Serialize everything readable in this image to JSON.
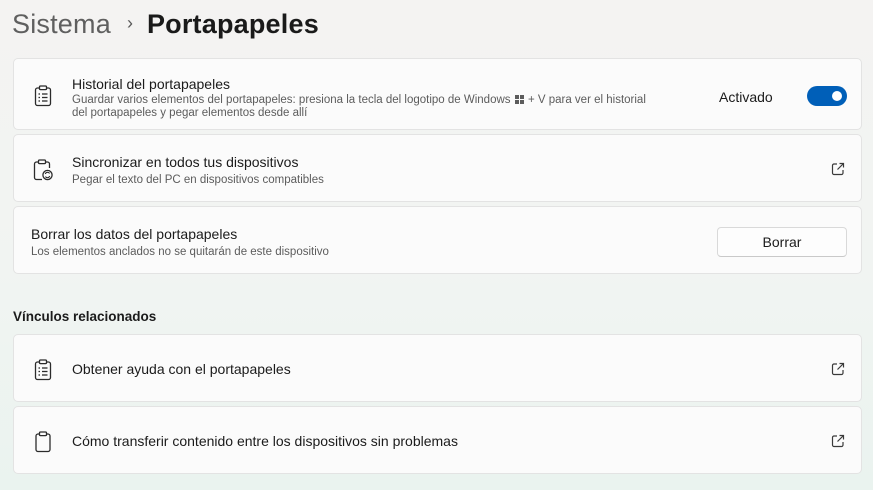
{
  "breadcrumb": {
    "parent": "Sistema",
    "separator": "›",
    "current": "Portapapeles"
  },
  "cards": {
    "history": {
      "title": "Historial del portapapeles",
      "desc_before_logo": "Guardar varios elementos del portapapeles: presiona la tecla del logotipo de Windows",
      "desc_after_logo": " + V para ver el historial",
      "desc_line2": "del portapapeles y pegar elementos desde allí",
      "state_label": "Activado",
      "toggle_on": true,
      "icon": "clipboard-list-icon"
    },
    "sync": {
      "title": "Sincronizar en todos tus dispositivos",
      "desc": "Pegar el texto del PC en dispositivos compatibles",
      "icon": "clipboard-sync-icon"
    },
    "clear": {
      "title": "Borrar los datos del portapapeles",
      "desc": "Los elementos anclados no se quitarán de este dispositivo",
      "button_label": "Borrar"
    }
  },
  "related": {
    "heading": "Vínculos relacionados",
    "links": [
      {
        "label": "Obtener ayuda con el portapapeles",
        "icon": "clipboard-list-icon"
      },
      {
        "label": "Cómo transferir contenido entre los dispositivos sin problemas",
        "icon": "clipboard-icon"
      }
    ]
  },
  "colors": {
    "accent": "#005fb8"
  }
}
